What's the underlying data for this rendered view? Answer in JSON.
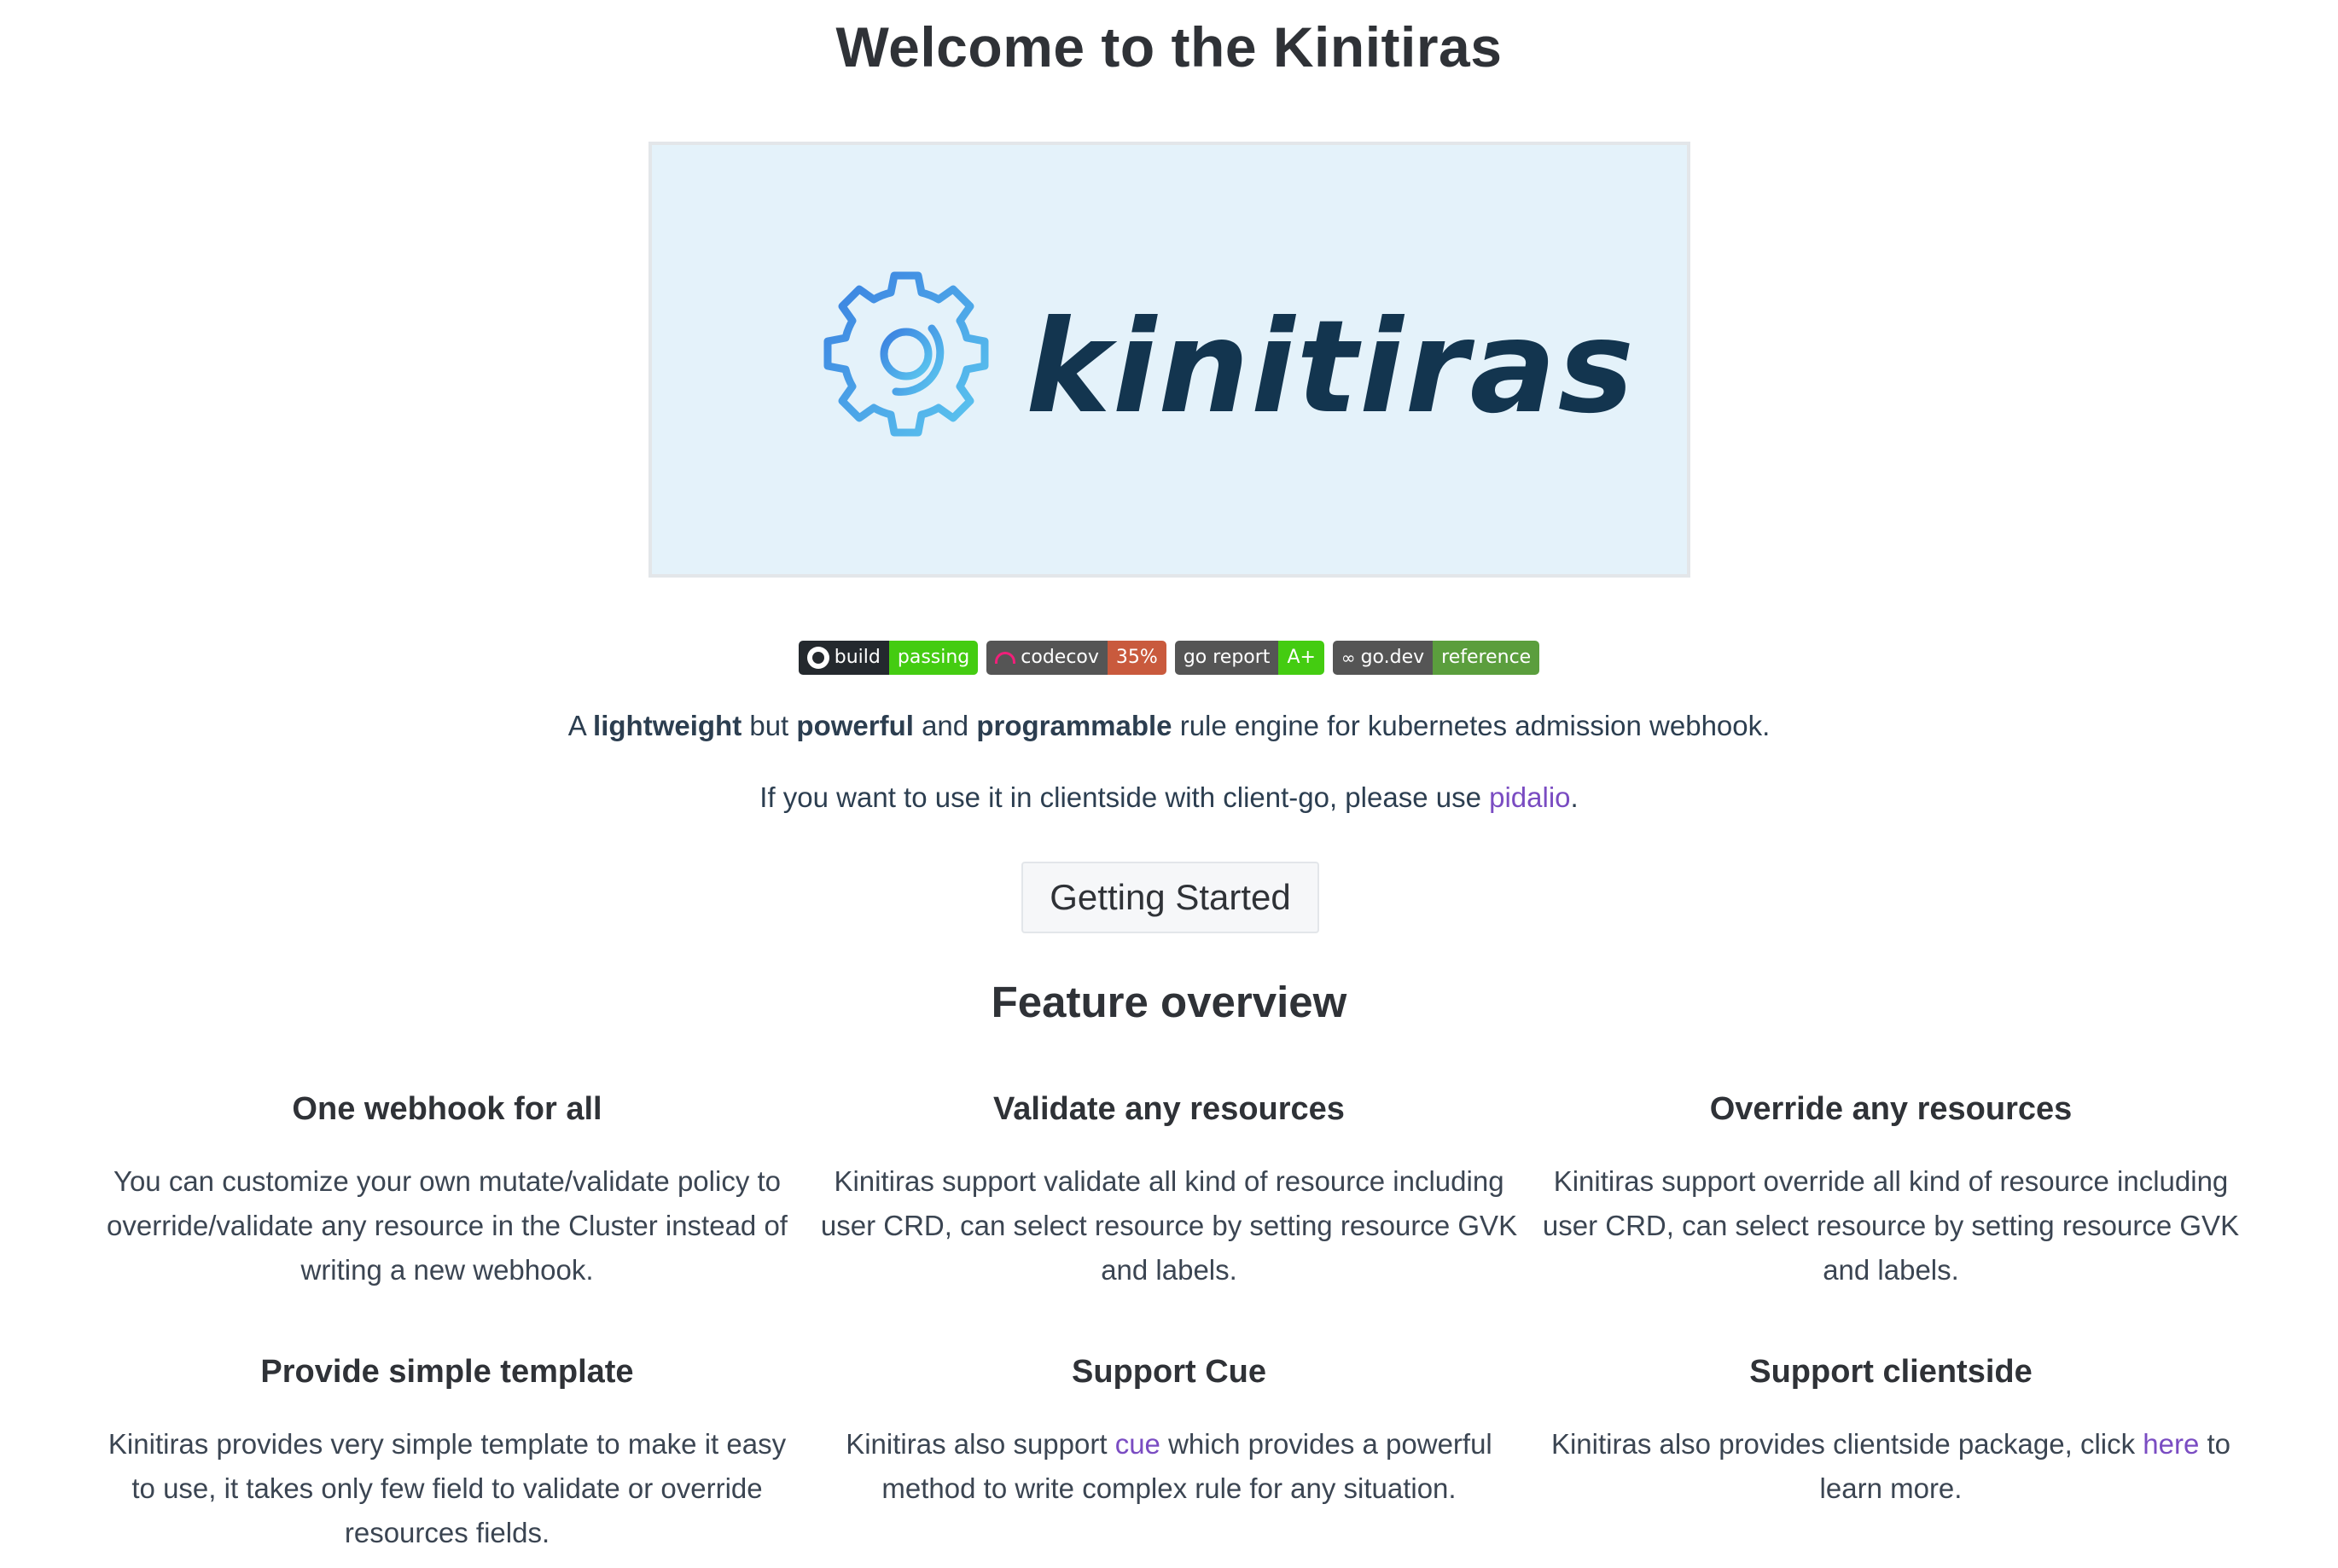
{
  "page": {
    "title": "Welcome to the Kinitiras"
  },
  "hero": {
    "logo_text": "kinitiras",
    "logo_icon": "gear-icon"
  },
  "badges": [
    {
      "left": "build",
      "right": "passing",
      "icon": "github-icon",
      "right_color": "#4c1"
    },
    {
      "left": "codecov",
      "right": "35%",
      "icon": "umbrella-icon",
      "right_color": "#e05d44"
    },
    {
      "left": "go report",
      "right": "A+",
      "icon": "",
      "right_color": "#4c1"
    },
    {
      "left": "go.dev",
      "right": "reference",
      "icon": "go-icon",
      "right_color": "#5b9e3d"
    }
  ],
  "intro": {
    "part1": "A ",
    "bold1": "lightweight",
    "part2": " but ",
    "bold2": "powerful",
    "part3": " and ",
    "bold3": "programmable",
    "part4": " rule engine for kubernetes admission webhook."
  },
  "clientside_note": {
    "text": "If you want to use it in clientside with client-go, please use ",
    "link": "pidalio",
    "suffix": "."
  },
  "cta": {
    "label": "Getting Started"
  },
  "features_heading": "Feature overview",
  "features": [
    {
      "title": "One webhook for all",
      "text": "You can customize your own mutate/validate policy to override/validate any resource in the Cluster instead of writing a new webhook."
    },
    {
      "title": "Validate any resources",
      "text": "Kinitiras support validate all kind of resource including user CRD, can select resource by setting resource GVK and labels."
    },
    {
      "title": "Override any resources",
      "text": "Kinitiras support override all kind of resource including user CRD, can select resource by setting resource GVK and labels."
    },
    {
      "title": "Provide simple template",
      "text": "Kinitiras provides very simple template to make it easy to use, it takes only few field to validate or override resources fields."
    },
    {
      "title": "Support Cue",
      "text_before": "Kinitiras also support ",
      "link": "cue",
      "text_after": " which provides a powerful method to write complex rule for any situation."
    },
    {
      "title": "Support clientside",
      "text_before": "Kinitiras also provides clientside package, click ",
      "link": "here",
      "text_after": " to learn more."
    }
  ],
  "colors": {
    "heading": "#2f3237",
    "link": "#7a4cc2",
    "hero_bg": "#e4f2fa",
    "logo_dark": "#13354f",
    "gear_blue": "#3d8fe0"
  }
}
